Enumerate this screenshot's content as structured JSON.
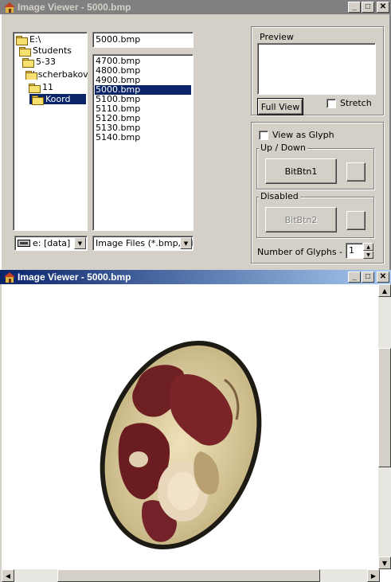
{
  "window1": {
    "title": "Image Viewer - 5000.bmp",
    "directories": [
      {
        "label": "E:\\",
        "selected": false
      },
      {
        "label": "Students",
        "selected": false
      },
      {
        "label": "5-33",
        "selected": false
      },
      {
        "label": "shscherbakov",
        "selected": false
      },
      {
        "label": "11",
        "selected": false
      },
      {
        "label": "Koord",
        "selected": true
      }
    ],
    "filename_value": "5000.bmp",
    "files": [
      {
        "label": "4700.bmp",
        "selected": false
      },
      {
        "label": "4800.bmp",
        "selected": false
      },
      {
        "label": "4900.bmp",
        "selected": false
      },
      {
        "label": "5000.bmp",
        "selected": true
      },
      {
        "label": "5100.bmp",
        "selected": false
      },
      {
        "label": "5110.bmp",
        "selected": false
      },
      {
        "label": "5120.bmp",
        "selected": false
      },
      {
        "label": "5130.bmp",
        "selected": false
      },
      {
        "label": "5140.bmp",
        "selected": false
      }
    ],
    "drive": "e: [data]",
    "filter": "Image Files (*.bmp, *.ico",
    "preview_label": "Preview",
    "full_view_label": "Full View",
    "stretch_label": "Stretch",
    "view_as_glyph_label": "View as Glyph",
    "updown_label": "Up / Down",
    "bitbtn1_label": "BitBtn1",
    "disabled_label": "Disabled",
    "bitbtn2_label": "BitBtn2",
    "glyph_count_label": "Number of Glyphs -",
    "glyph_count_value": "1"
  },
  "window2": {
    "title": "Image Viewer - 5000.bmp"
  },
  "colors": {
    "selection": "#0a246a",
    "face": "#d4d0c8",
    "meat": "#6e1f22",
    "fat": "#e8d7a8"
  }
}
